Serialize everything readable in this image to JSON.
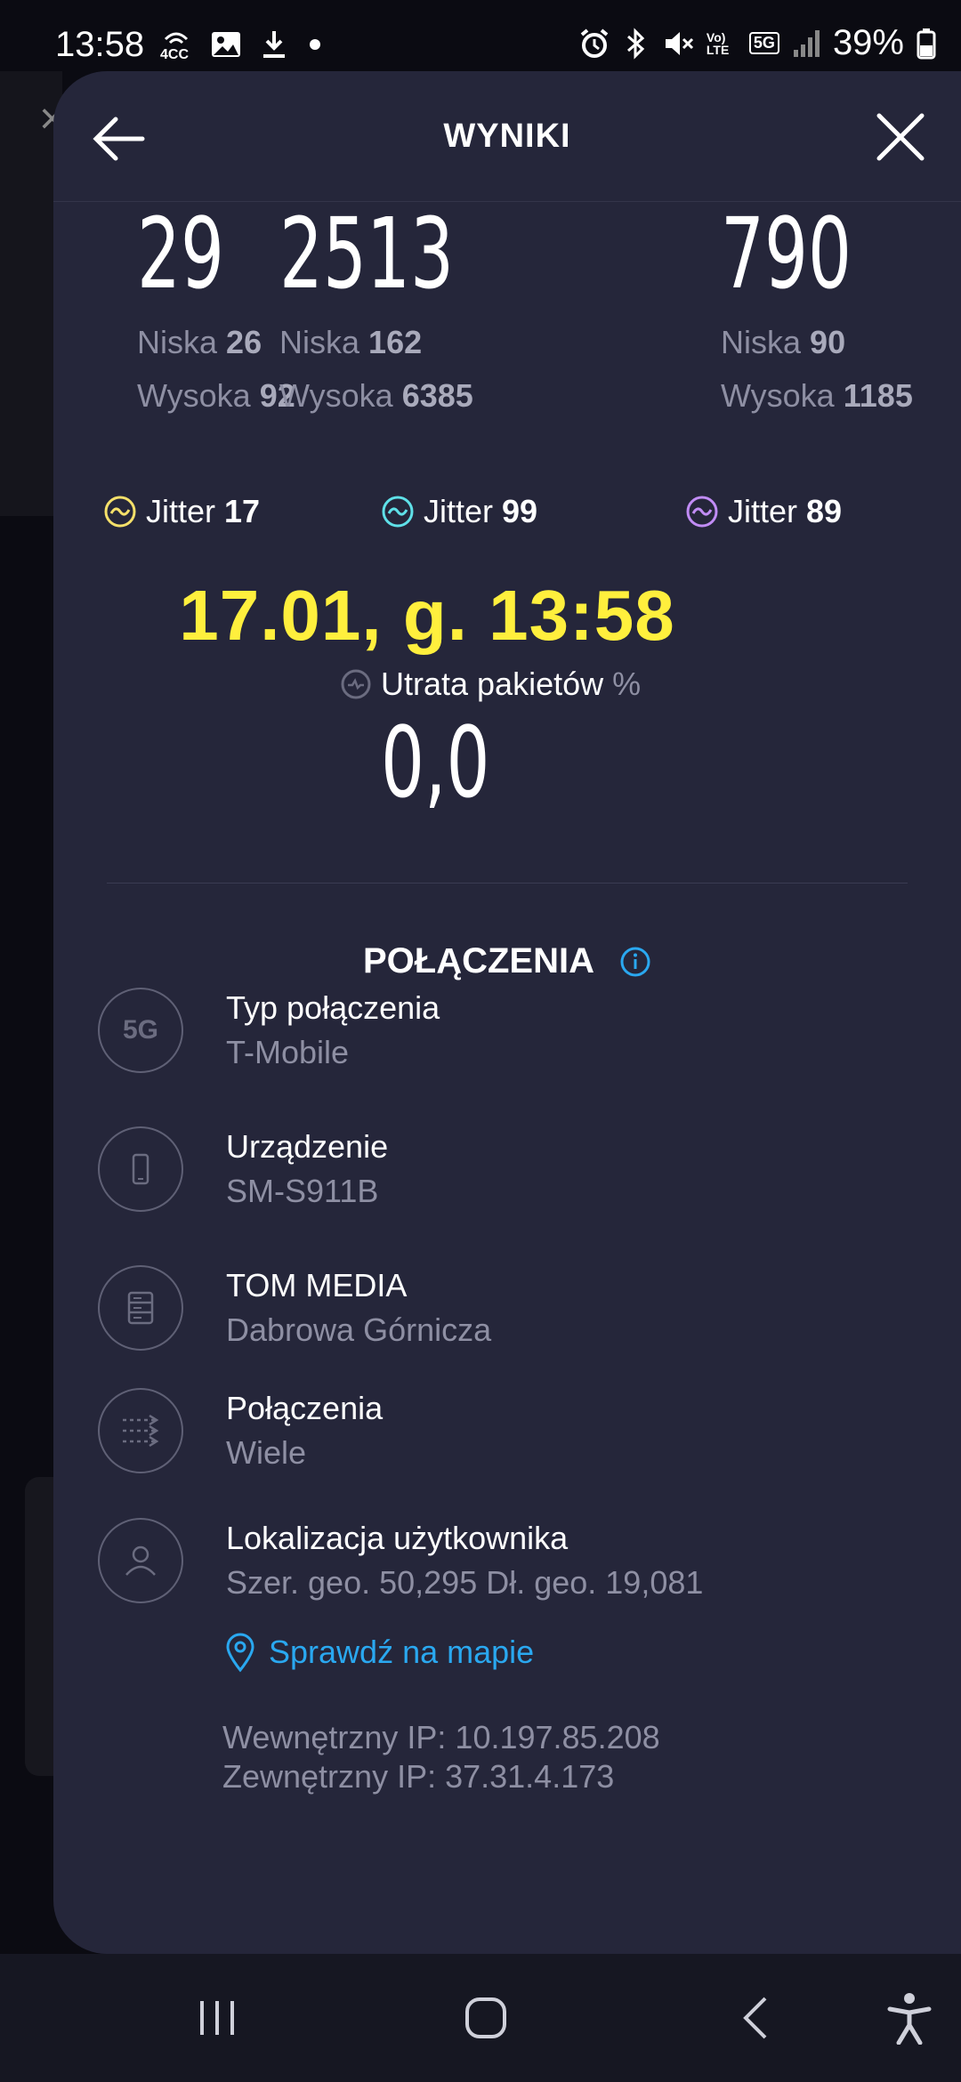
{
  "status_bar": {
    "time": "13:58",
    "left_icons": [
      "4cc-icon",
      "gallery-icon",
      "download-icon",
      "dot-icon"
    ],
    "right_icons": [
      "alarm-icon",
      "bluetooth-icon",
      "mute-icon",
      "volte-icon",
      "5g-icon",
      "signal-icon",
      "battery-icon"
    ],
    "volte_label": "Vo) LTE",
    "fiveg_label": "5G",
    "battery": "39%"
  },
  "header": {
    "title": "WYNIKI"
  },
  "metrics": [
    {
      "value": "29",
      "low_label": "Niska",
      "low_value": "26",
      "high_label": "Wysoka",
      "high_value": "92",
      "jitter_label": "Jitter",
      "jitter_value": "17",
      "jitter_color": "#f5e06a"
    },
    {
      "value": "2513",
      "low_label": "Niska",
      "low_value": "162",
      "high_label": "Wysoka",
      "high_value": "6385",
      "jitter_label": "Jitter",
      "jitter_value": "99",
      "jitter_color": "#5fe0e8"
    },
    {
      "value": "790",
      "low_label": "Niska",
      "low_value": "90",
      "high_label": "Wysoka",
      "high_value": "1185",
      "jitter_label": "Jitter",
      "jitter_value": "89",
      "jitter_color": "#c18cf5"
    }
  ],
  "date": "17.01, g. 13:58",
  "packet_loss": {
    "label": "Utrata pakietów",
    "unit": "%",
    "value": "0,0"
  },
  "connections": {
    "title": "POŁĄCZENIA",
    "items": [
      {
        "icon": "5g-icon",
        "icon_text": "5G",
        "title": "Typ połączenia",
        "value": "T-Mobile"
      },
      {
        "icon": "phone-icon",
        "title": "Urządzenie",
        "value": "SM-S911B"
      },
      {
        "icon": "server-icon",
        "title": "TOM MEDIA",
        "value": "Dabrowa Górnicza"
      },
      {
        "icon": "multi-connection-icon",
        "title": "Połączenia",
        "value": "Wiele"
      },
      {
        "icon": "user-icon",
        "title": "Lokalizacja użytkownika",
        "value": "Szer. geo. 50,295 Dł. geo. 19,081"
      }
    ],
    "map_link": "Sprawdź na mapie",
    "internal_ip": "Wewnętrzny IP: 10.197.85.208",
    "external_ip": "Zewnętrzny IP: 37.31.4.173"
  },
  "colors": {
    "sheet_bg": "#25263a",
    "date_yellow": "#ffef3d",
    "link_blue": "#2aa8f0"
  }
}
